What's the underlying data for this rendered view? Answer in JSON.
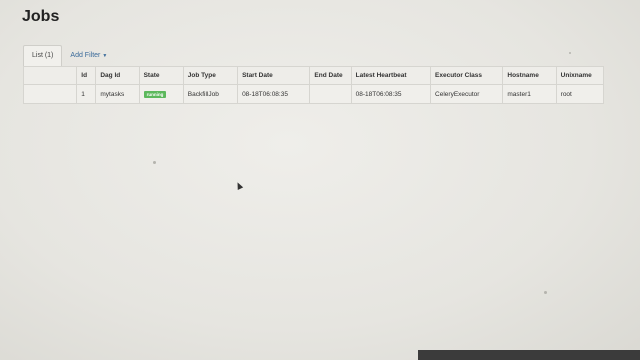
{
  "page": {
    "title": "Jobs"
  },
  "tabs": [
    {
      "label": "List (1)"
    },
    {
      "label": "Add Filter"
    }
  ],
  "table": {
    "columns": [
      "",
      "Id",
      "Dag Id",
      "State",
      "Job Type",
      "Start Date",
      "End Date",
      "Latest Heartbeat",
      "Executor Class",
      "Hostname",
      "Unixname"
    ],
    "rows": [
      {
        "select": "",
        "id": "1",
        "dag_id": "mytasks",
        "state": "running",
        "job_type": "BackfillJob",
        "start_date": "08-18T06:08:35",
        "end_date": "",
        "latest_heartbeat": "08-18T06:08:35",
        "executor_class": "CeleryExecutor",
        "hostname": "master1",
        "unixname": "root"
      }
    ]
  },
  "colors": {
    "state_running": "#5cb85c",
    "link": "#3a6a9a"
  },
  "icons": {
    "add_filter_caret": "caret-down-icon",
    "cursor": "mouse-pointer-icon"
  }
}
